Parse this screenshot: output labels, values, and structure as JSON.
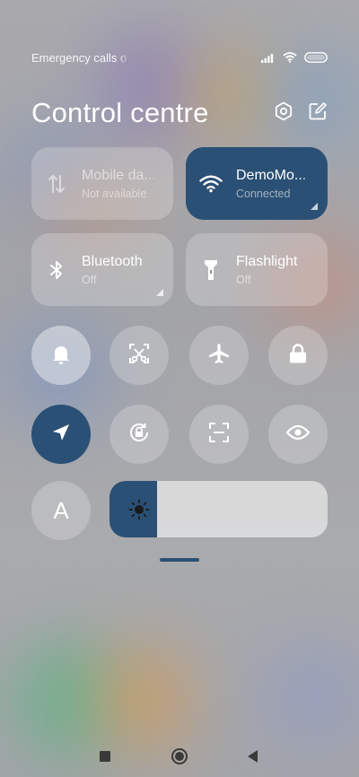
{
  "status_bar": {
    "carrier_text": "Emergency calls o",
    "icons": [
      "signal-icon",
      "wifi-icon",
      "battery-icon"
    ]
  },
  "header": {
    "title": "Control centre",
    "actions": [
      "settings-icon",
      "edit-icon"
    ]
  },
  "tiles": [
    {
      "label": "Mobile da...",
      "sub": "Not available",
      "icon": "mobile-data-icon",
      "state": "unavailable"
    },
    {
      "label": "DemoMo...",
      "sub": "Connected",
      "icon": "wifi-icon",
      "state": "active"
    },
    {
      "label": "Bluetooth",
      "sub": "Off",
      "icon": "bluetooth-icon",
      "state": "off"
    },
    {
      "label": "Flashlight",
      "sub": "Off",
      "icon": "flashlight-icon",
      "state": "off"
    }
  ],
  "toggles": [
    {
      "name": "sound",
      "icon": "bell-icon",
      "state": "on"
    },
    {
      "name": "screenshot",
      "icon": "screenshot-icon",
      "state": "off"
    },
    {
      "name": "airplane-mode",
      "icon": "airplane-icon",
      "state": "off"
    },
    {
      "name": "lock-screen",
      "icon": "lock-icon",
      "state": "off"
    },
    {
      "name": "location",
      "icon": "location-icon",
      "state": "active"
    },
    {
      "name": "auto-rotate",
      "icon": "rotate-lock-icon",
      "state": "off"
    },
    {
      "name": "scanner",
      "icon": "scan-icon",
      "state": "off"
    },
    {
      "name": "reading-mode",
      "icon": "eye-icon",
      "state": "off"
    },
    {
      "name": "font-size",
      "icon": "font-icon",
      "state": "off",
      "glyph": "A"
    }
  ],
  "brightness": {
    "level": 0.22,
    "icon": "sun-icon"
  },
  "navigation": [
    "recents-button",
    "home-button",
    "back-button"
  ],
  "colors": {
    "accent": "#2b5075"
  }
}
